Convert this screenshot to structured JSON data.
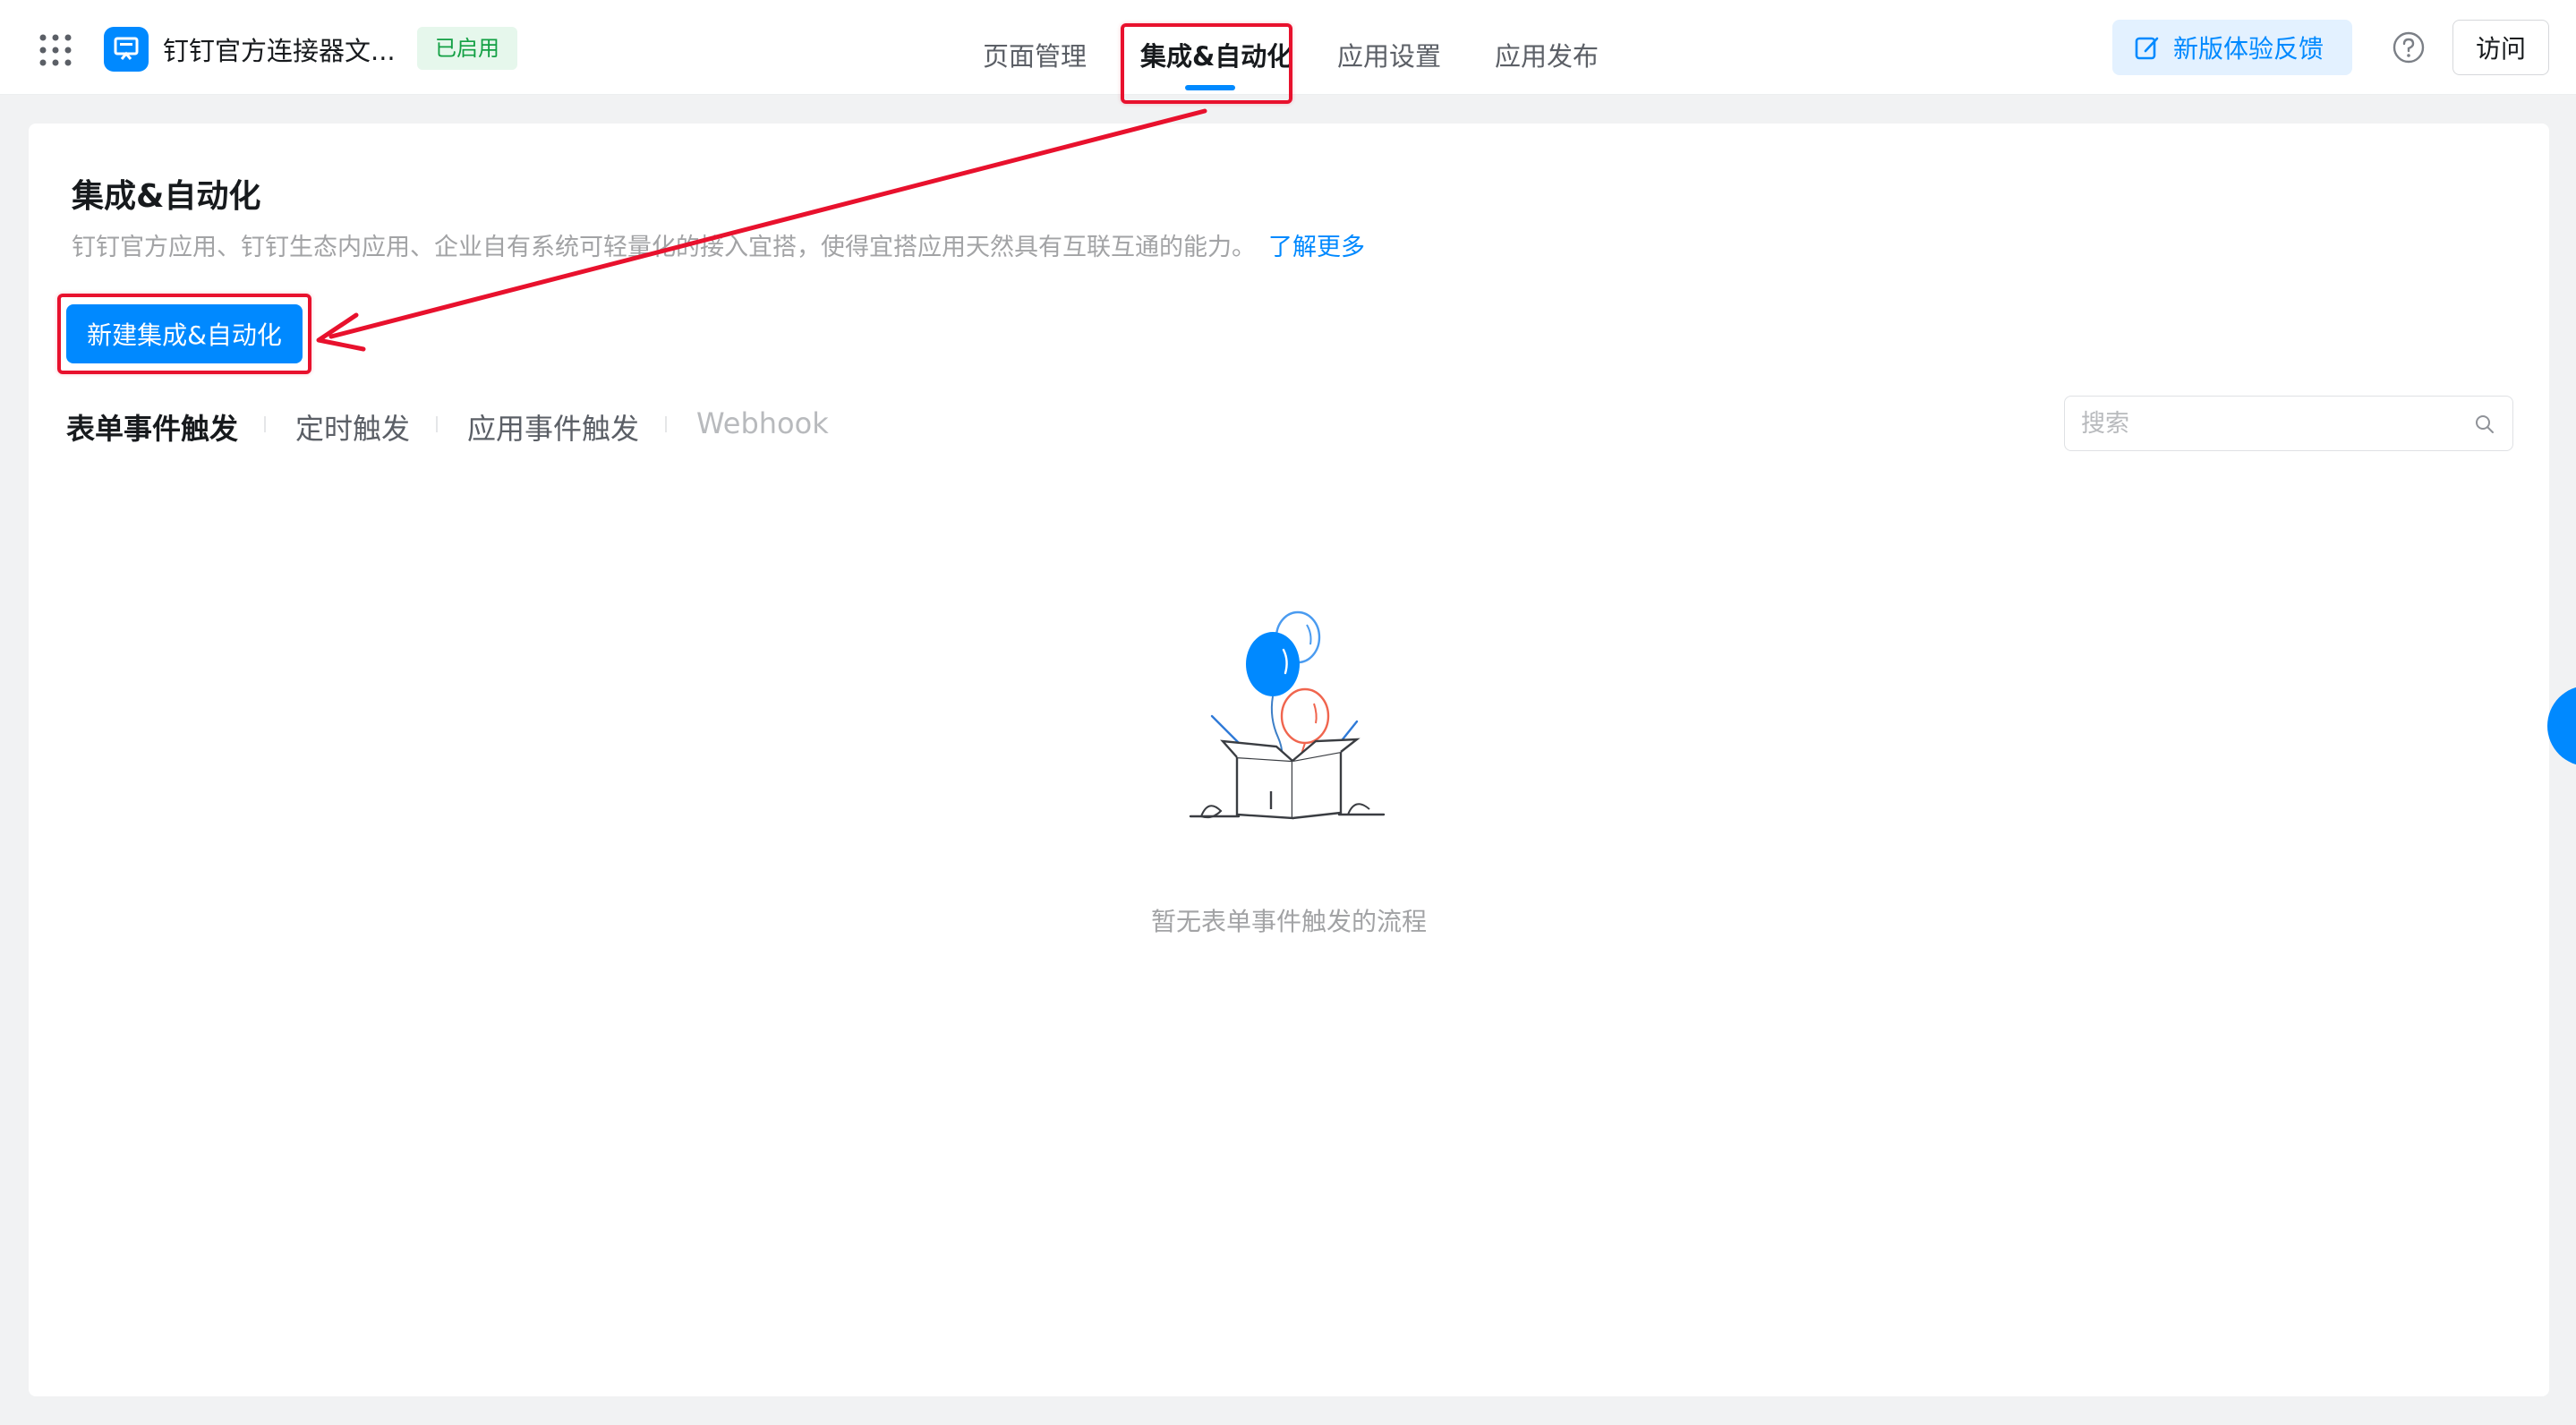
{
  "header": {
    "app_name": "钉钉官方连接器文...",
    "status_badge": "已启用",
    "nav_tabs": [
      {
        "label": "页面管理"
      },
      {
        "label": "集成&自动化"
      },
      {
        "label": "应用设置"
      },
      {
        "label": "应用发布"
      }
    ],
    "active_tab": "集成&自动化",
    "feedback_label": "新版体验反馈",
    "visit_label": "访问"
  },
  "main": {
    "title": "集成&自动化",
    "description": "钉钉官方应用、钉钉生态内应用、企业自有系统可轻量化的接入宜搭，使得宜搭应用天然具有互联互通的能力。",
    "learn_more": "了解更多",
    "create_button": "新建集成&自动化",
    "sub_tabs": [
      {
        "label": "表单事件触发"
      },
      {
        "label": "定时触发"
      },
      {
        "label": "应用事件触发"
      },
      {
        "label": "Webhook"
      }
    ],
    "active_sub_tab": "表单事件触发",
    "search": {
      "placeholder": "搜索",
      "value": ""
    },
    "empty_text": "暂无表单事件触发的流程"
  },
  "colors": {
    "brand": "#0089ff",
    "highlight": "#e8112d",
    "badge_bg": "#e6f7ec",
    "badge_text": "#13a044"
  },
  "icons": [
    "grid-icon",
    "app-logo-icon",
    "edit-icon",
    "help-icon",
    "search-icon",
    "empty-box-illustration"
  ]
}
